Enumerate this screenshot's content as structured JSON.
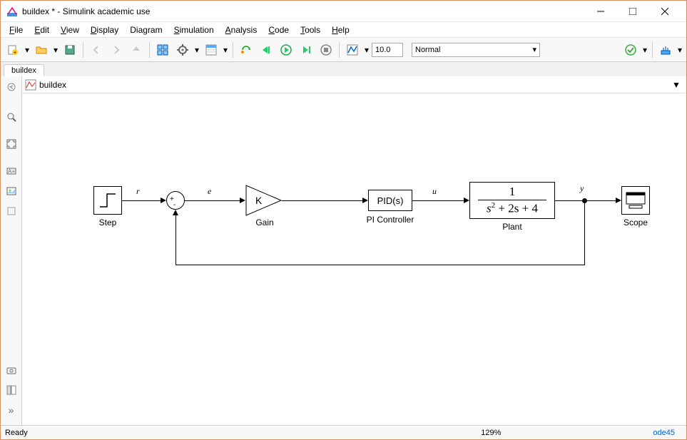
{
  "window": {
    "title": "buildex * - Simulink academic use"
  },
  "menu": {
    "file": "File",
    "edit": "Edit",
    "view": "View",
    "display": "Display",
    "diagram": "Diagram",
    "simulation": "Simulation",
    "analysis": "Analysis",
    "code": "Code",
    "tools": "Tools",
    "help": "Help"
  },
  "toolbar": {
    "stop_time": "10.0",
    "sim_mode": "Normal"
  },
  "tabs": {
    "active": "buildex"
  },
  "breadcrumb": {
    "model": "buildex"
  },
  "diagram": {
    "blocks": {
      "step": "Step",
      "gain_inner": "K",
      "gain": "Gain",
      "pid_inner": "PID(s)",
      "pid": "PI Controller",
      "plant_numer": "1",
      "plant_denom_sq": "s",
      "plant_denom_exp": "2",
      "plant_denom_tail": " + 2s + 4",
      "plant": "Plant",
      "scope": "Scope"
    },
    "signals": {
      "r": "r",
      "e": "e",
      "u": "u",
      "y": "y"
    },
    "sum": {
      "plus": "+",
      "minus": "−"
    }
  },
  "status": {
    "ready": "Ready",
    "zoom": "129%",
    "solver": "ode45"
  }
}
